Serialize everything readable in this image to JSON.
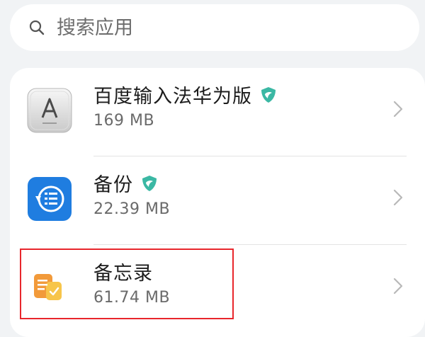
{
  "search": {
    "placeholder": "搜索应用",
    "icon": "search-icon"
  },
  "apps": [
    {
      "name": "百度输入法华为版",
      "size": "169 MB",
      "icon": "keyboard-a-icon",
      "verified": true
    },
    {
      "name": "备份",
      "size": "22.39 MB",
      "icon": "backup-icon",
      "verified": true
    },
    {
      "name": "备忘录",
      "size": "61.74 MB",
      "icon": "notepad-icon",
      "verified": false,
      "highlighted": true
    }
  ],
  "colors": {
    "page_background": "#f1f3f5",
    "card_background": "#ffffff",
    "highlight_border": "#e8262c",
    "verify_badge": "#3bb8a4",
    "backup_icon": "#1f7de0",
    "notepad_icon": "#f2a33a"
  }
}
